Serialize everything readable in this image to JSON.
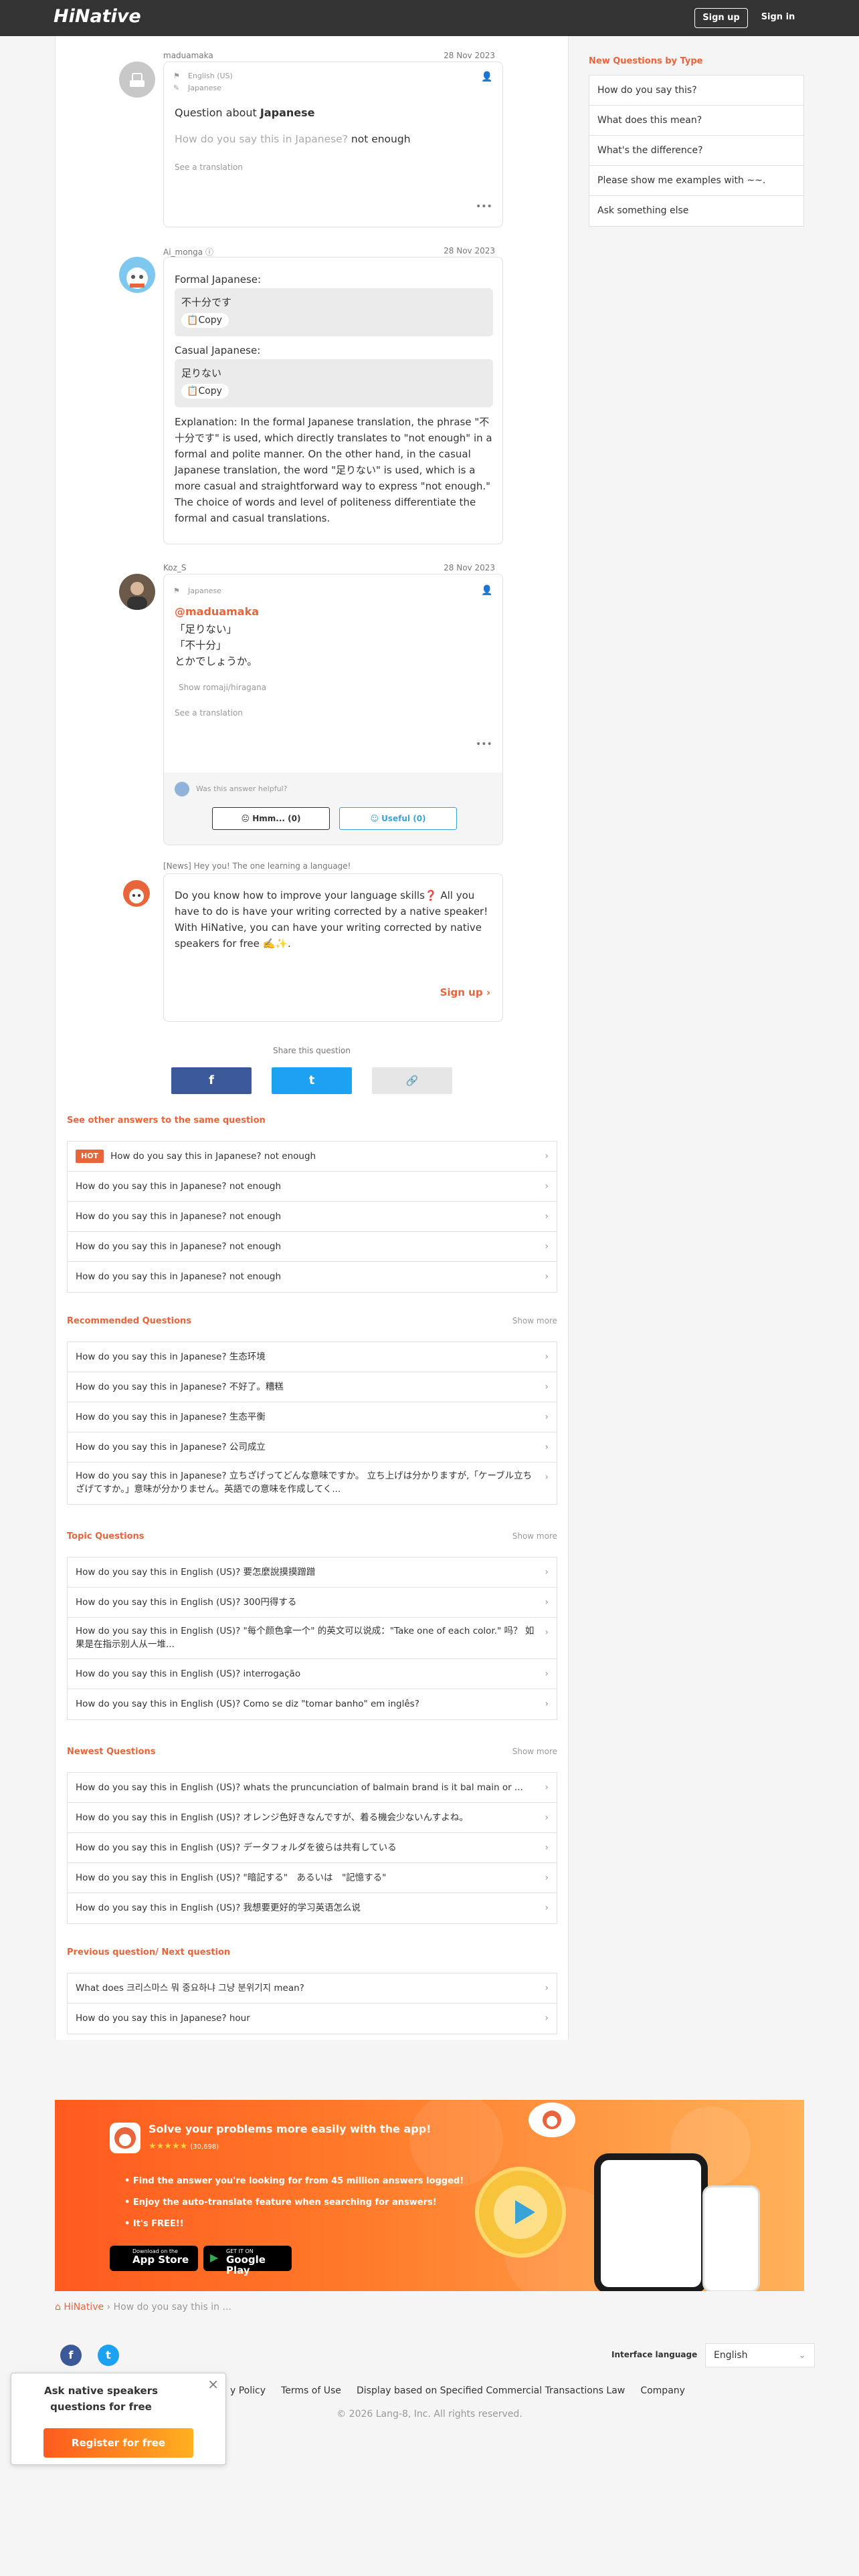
{
  "header": {
    "logo": "HiNative",
    "signup": "Sign up",
    "signin": "Sign in"
  },
  "sidebar": {
    "title": "New Questions by Type",
    "items": [
      "How do you say this?",
      "What does this mean?",
      "What's the difference?",
      "Please show me examples with ~~.",
      "Ask something else"
    ]
  },
  "question": {
    "user": "maduamaka",
    "date": "28 Nov 2023",
    "lang1": "English (US)",
    "lang2": "Japanese",
    "title_prefix": "Question about",
    "title_lang": "Japanese",
    "body_prefix": "How do you say this in Japanese?",
    "body_text": "not enough",
    "see_translation": "See a translation",
    "more": "•••"
  },
  "answer1": {
    "user": "Ai_monga",
    "date": "28 Nov 2023",
    "formal_label": "Formal Japanese:",
    "formal_text": "不十分です",
    "copy": "Copy",
    "casual_label": "Casual Japanese:",
    "casual_text": "足りない",
    "explanation": "Explanation: In the formal Japanese translation, the phrase \"不十分です\" is used, which directly translates to \"not enough\" in a formal and polite manner. On the other hand, in the casual Japanese translation, the word \"足りない\" is used, which is a more casual and straightforward way to express \"not enough.\" The choice of words and level of politeness differentiate the formal and casual translations."
  },
  "answer2": {
    "user": "Koz_S",
    "date": "28 Nov 2023",
    "lang": "Japanese",
    "mention": "@maduamaka",
    "line1": "「足りない」",
    "line2": "「不十分」",
    "line3": "とかでしょうか。",
    "show_romaji": "Show romaji/hiragana",
    "see_translation": "See a translation",
    "more": "•••",
    "helpful": "Was this answer helpful?",
    "hmm": "Hmm... (0)",
    "useful": "Useful (0)"
  },
  "promo": {
    "label": "[News] Hey you! The one learning a language!",
    "text1": "Do you know how to improve your language skills❓ All you have to do is have your writing corrected by a native speaker!",
    "text2": "With HiNative, you can have your writing corrected by native speakers for free ✍️✨.",
    "signup": "Sign up"
  },
  "share": {
    "title": "Share this question",
    "fb": "f",
    "tw": "t",
    "link": "🔗"
  },
  "same_question": {
    "title": "See other answers to the same question",
    "hot": "HOT",
    "items": [
      "How do you say this in Japanese? not enough",
      "How do you say this in Japanese? not enough",
      "How do you say this in Japanese? not enough",
      "How do you say this in Japanese? not enough",
      "How do you say this in Japanese? not enough"
    ]
  },
  "recommended": {
    "title": "Recommended Questions",
    "show_more": "Show more",
    "items": [
      "How do you say this in Japanese? 生态环境",
      "How do you say this in Japanese? 不好了。糟糕",
      "How do you say this in Japanese? 生态平衡",
      "How do you say this in Japanese? 公司成立",
      "How do you say this in Japanese? 立ちざげってどんな意味ですか。 立ち上げは分かりますが,「ケーブル立ちざげてすか。」意味が分かりません。英語での意味を作成してく..."
    ]
  },
  "topic": {
    "title": "Topic Questions",
    "show_more": "Show more",
    "items": [
      "How do you say this in English (US)? 要怎麼說摸摸蹭蹭",
      "How do you say this in English (US)? 300円得する",
      "How do you say this in English (US)? \"每个颜色拿一个\" 的英文可以说成：\"Take one of each color.\" 吗？ 如果是在指示别人从一堆...",
      "How do you say this in English (US)? interrogação",
      "How do you say this in English (US)? Como se diz \"tomar banho\" em inglês?"
    ]
  },
  "newest": {
    "title": "Newest Questions",
    "show_more": "Show more",
    "items": [
      "How do you say this in English (US)? whats the pruncunciation of balmain brand is it bal main or ...",
      "How do you say this in English (US)? オレンジ色好きなんですが、着る機会少ないんすよね。",
      "How do you say this in English (US)? データフォルダを彼らは共有している",
      "How do you say this in English (US)? \"暗記する\"　あるいは　\"記憶する\"",
      "How do you say this in English (US)? 我想要更好的学习英语怎么说"
    ]
  },
  "prevnext": {
    "title": "Previous question/ Next question",
    "items": [
      "What does 크리스마스 뭐 중요하냐 그냥 분위기지 mean?",
      "How do you say this in Japanese? hour"
    ]
  },
  "banner": {
    "headline": "Solve your problems more easily with the app!",
    "rating": "(30,698)",
    "b1": "Find the answer you're looking for from 45 million answers logged!",
    "b2": "Enjoy the auto-translate feature when searching for answers!",
    "b3": "It's FREE!!",
    "appstore_small": "Download on the",
    "appstore": "App Store",
    "gplay_small": "GET IT ON",
    "gplay": "Google Play"
  },
  "breadcrumb": {
    "home": "HiNative",
    "current": "How do you say this in ..."
  },
  "footer": {
    "lang_label": "Interface language",
    "lang_value": "English",
    "links": [
      "y Policy",
      "Terms of Use",
      "Display based on Specified Commercial Transactions Law",
      "Company"
    ],
    "copyright": "© 2026 Lang-8, Inc. All rights reserved."
  },
  "popup": {
    "text": "Ask native speakers questions for free",
    "button": "Register for free",
    "close": "×"
  },
  "colors": {
    "accent": "#e8653c",
    "header": "#333333",
    "facebook": "#3b5998",
    "twitter": "#1da1f2"
  }
}
